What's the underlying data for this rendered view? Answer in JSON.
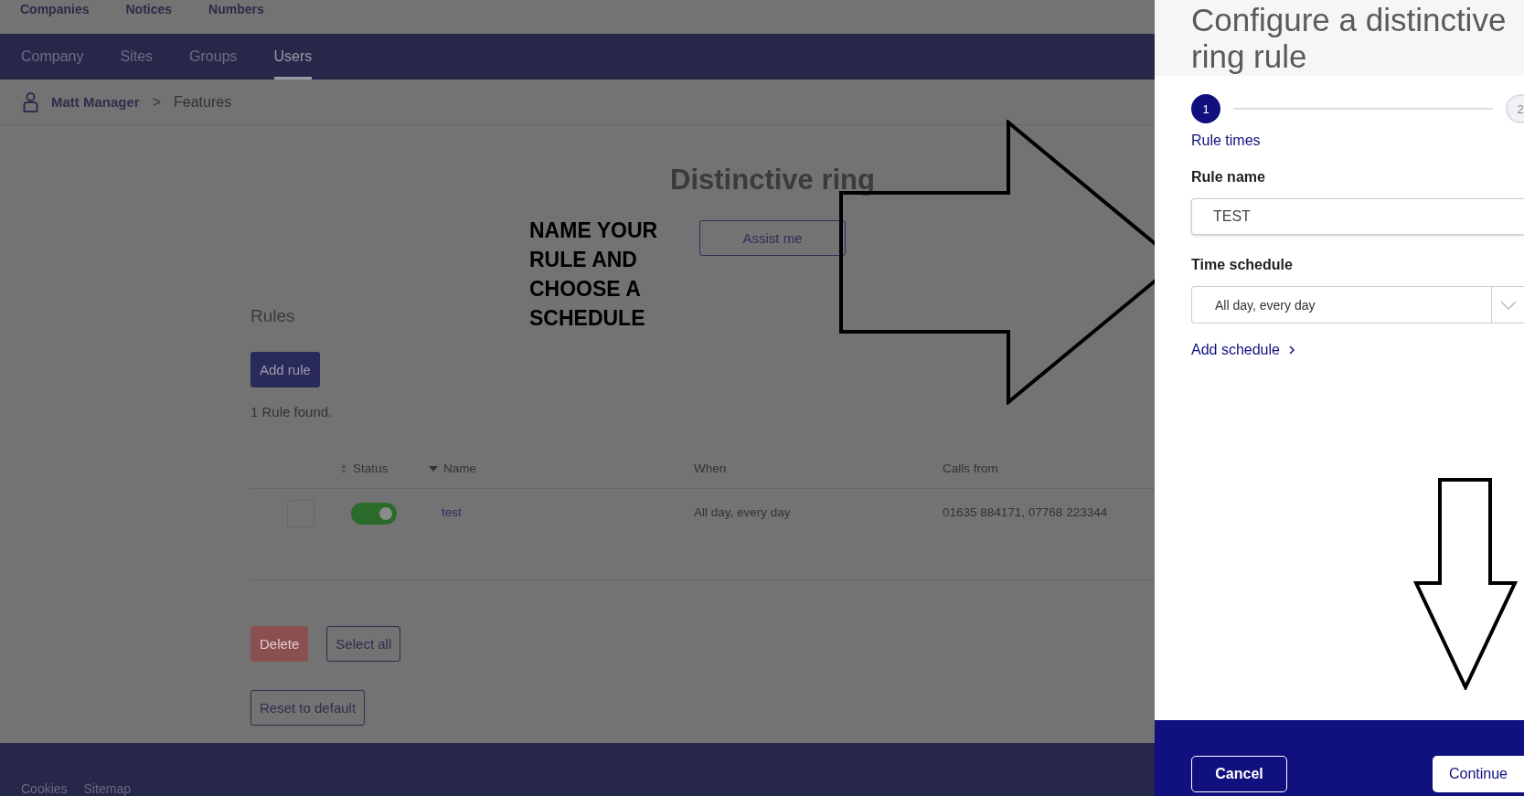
{
  "top_links": [
    "Companies",
    "Notices",
    "Numbers"
  ],
  "nav_tabs": [
    {
      "label": "Company",
      "selected": false
    },
    {
      "label": "Sites",
      "selected": false
    },
    {
      "label": "Groups",
      "selected": false
    },
    {
      "label": "Users",
      "selected": true
    }
  ],
  "breadcrumb": {
    "items": [
      "Matt Manager",
      "Features"
    ],
    "separator": ">"
  },
  "page": {
    "title": "Distinctive ring",
    "assist_button": "Assist me",
    "rules_heading": "Rules",
    "add_rule_button": "Add rule",
    "count": "1 Rule found.",
    "table": {
      "columns": [
        {
          "label": "Status",
          "kind": "sortable"
        },
        {
          "label": "Name",
          "kind": "sorted"
        },
        {
          "label": "When",
          "kind": "plain"
        },
        {
          "label": "Calls from",
          "kind": "plain"
        }
      ],
      "rows": [
        {
          "name": "test",
          "when": "All day, every day",
          "calls_from": "01635 884171, 07768 223344",
          "enabled": true,
          "checked": false
        }
      ]
    },
    "delete_button": {
      "label": "Delete",
      "disabled": true
    },
    "select_all_button": "Select all",
    "reset_button": "Reset to default"
  },
  "footer_links": [
    "Cookies",
    "Sitemap"
  ],
  "annotation": {
    "text": "NAME YOUR RULE AND CHOOSE A SCHEDULE"
  },
  "panel": {
    "title": "Configure a distinctive ring rule",
    "steps": [
      {
        "number": "1",
        "label": "Rule times",
        "selected": true
      },
      {
        "number": "2",
        "selected": false
      }
    ],
    "rule_name": {
      "label": "Rule name",
      "value": "TEST"
    },
    "time_schedule": {
      "label": "Time schedule",
      "value": "All day, every day"
    },
    "add_schedule": "Add schedule",
    "cancel_button": "Cancel",
    "continue_button": "Continue"
  }
}
